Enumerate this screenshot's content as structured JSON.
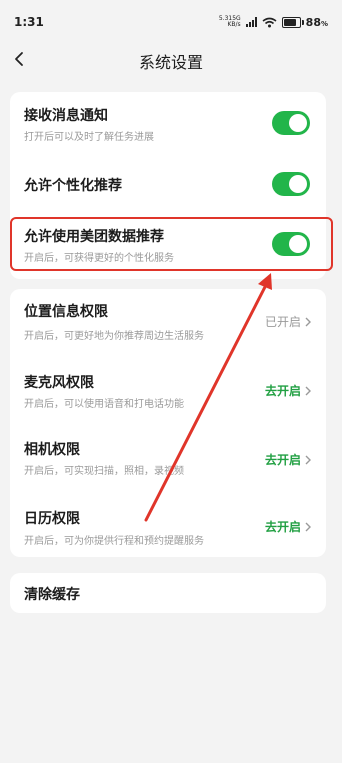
{
  "status_bar": {
    "time": "1:31",
    "net_speed": "5.31",
    "net_unit": "KB/s",
    "net_type": "5G",
    "battery": "88",
    "battery_unit": "%"
  },
  "nav": {
    "title": "系统设置",
    "back_icon": "chevron-left-icon"
  },
  "notifications_card": {
    "rows": [
      {
        "title": "接收消息通知",
        "subtitle": "打开后可以及时了解任务进展",
        "toggle_on": true
      },
      {
        "title": "允许个性化推荐",
        "toggle_on": true
      },
      {
        "title": "允许使用美团数据推荐",
        "subtitle": "开启后，可获得更好的个性化服务",
        "toggle_on": true
      }
    ]
  },
  "permissions_card": {
    "rows": [
      {
        "title": "位置信息权限",
        "subtitle": "开启后，可更好地为你推荐周边生活服务",
        "status": "已开启"
      },
      {
        "title": "麦克风权限",
        "subtitle": "开启后，可以使用语音和打电话功能",
        "status": "去开启"
      },
      {
        "title": "相机权限",
        "subtitle": "开启后，可实现扫描，照相，录视频",
        "status": "去开启"
      },
      {
        "title": "日历权限",
        "subtitle": "开启后，可为你提供行程和预约提醒服务",
        "status": "去开启"
      }
    ]
  },
  "cache_card": {
    "label": "清除缓存"
  },
  "colors": {
    "accent_green": "#22b54a",
    "highlight_red": "#e0352a",
    "background": "#f3f3f3"
  }
}
